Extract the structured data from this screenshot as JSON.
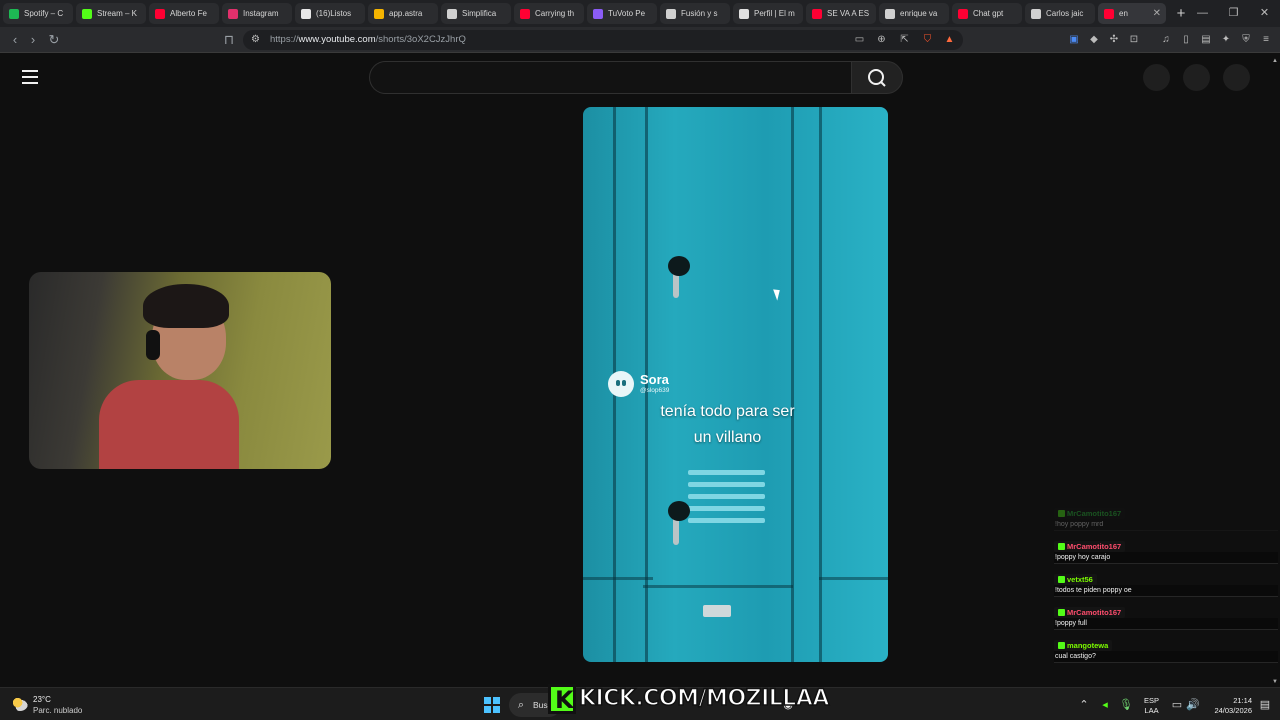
{
  "browser": {
    "tabs": [
      {
        "label": "Spotify – C",
        "color": "#1db954"
      },
      {
        "label": "Stream – K",
        "color": "#53fc18"
      },
      {
        "label": "Alberto Fe",
        "color": "#ff0033"
      },
      {
        "label": "Instagram",
        "color": "#e1306c"
      },
      {
        "label": "(16)Listos",
        "color": "#e8e8e8"
      },
      {
        "label": "app.astra",
        "color": "#f5b400"
      },
      {
        "label": "Simplifica",
        "color": "#d0d0d0"
      },
      {
        "label": "Carrying th",
        "color": "#ff0033"
      },
      {
        "label": "TuVoto Pe",
        "color": "#8b5cf6"
      },
      {
        "label": "Fusión y s",
        "color": "#d0d0d0"
      },
      {
        "label": "Perfil | El m",
        "color": "#e0e0e0"
      },
      {
        "label": "SE VA A ES",
        "color": "#ff0033"
      },
      {
        "label": "enrique va",
        "color": "#d0d0d0"
      },
      {
        "label": "Chat gpt",
        "color": "#ff0033"
      },
      {
        "label": "Carlos jaic",
        "color": "#d0d0d0"
      },
      {
        "label": "en",
        "color": "#ff0033"
      }
    ],
    "new_tab": "+",
    "url_prefix": "https://",
    "url_domain": "www.youtube.com",
    "url_path": "/shorts/3oX2CJzJhrQ"
  },
  "youtube": {
    "search_placeholder": ""
  },
  "short": {
    "author_name": "Sora",
    "author_handle": "@slop639",
    "caption_line1": "tenía todo para ser",
    "caption_line2": "un villano"
  },
  "chat": [
    {
      "user": "MrCamotito167",
      "user_color": "#2ecc40",
      "message": "!hoy poppy mrd",
      "faded": true
    },
    {
      "user": "MrCamotito167",
      "user_color": "#ff4d6d",
      "message": "!poppy hoy carajo",
      "faded": false
    },
    {
      "user": "vetxt56",
      "user_color": "#7cfc00",
      "message": "!todos te piden poppy oe",
      "faded": false
    },
    {
      "user": "MrCamotito167",
      "user_color": "#ff4d6d",
      "message": "!poppy full",
      "faded": false
    },
    {
      "user": "mangotewa",
      "user_color": "#7cfc00",
      "message": "cual castigo?",
      "faded": false
    }
  ],
  "taskbar": {
    "temperature": "23°C",
    "weather": "Parc. nublado",
    "search_label": "Bus",
    "kick_text": "KICK.COM/MOZILLAA",
    "lang_line1": "ESP",
    "lang_line2": "LAA",
    "time": "21:14",
    "date": "24/03/2026"
  }
}
